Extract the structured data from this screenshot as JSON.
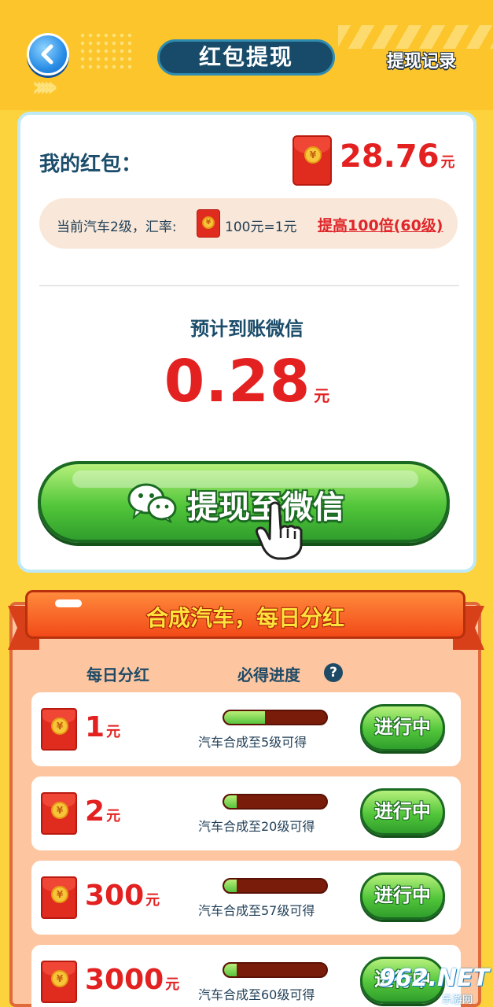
{
  "header": {
    "title": "红包提现",
    "history_link": "提现记录",
    "back_icon": "chevron-left-icon"
  },
  "balance": {
    "label": "我的红包：",
    "amount": "28.76",
    "unit": "元"
  },
  "rate": {
    "text": "当前汽车2级，汇率:",
    "value": "100元=1元",
    "boost_link": "提高100倍(60级)"
  },
  "expected": {
    "label": "预计到账微信",
    "amount": "0.28",
    "unit": "元"
  },
  "withdraw_button": {
    "label": "提现至微信",
    "icon": "wechat-icon"
  },
  "daily": {
    "banner": "合成汽车，每日分红",
    "col_reward": "每日分红",
    "col_progress": "必得进度",
    "help_icon": "?",
    "rows": [
      {
        "amount": "1",
        "unit": "元",
        "progress": 0.4,
        "condition": "汽车合成至5级可得",
        "status": "进行中"
      },
      {
        "amount": "2",
        "unit": "元",
        "progress": 0.1,
        "condition": "汽车合成至20级可得",
        "status": "进行中"
      },
      {
        "amount": "300",
        "unit": "元",
        "progress": 0.03,
        "condition": "汽车合成至57级可得",
        "status": "进行中"
      },
      {
        "amount": "3000",
        "unit": "元",
        "progress": 0.03,
        "condition": "汽车合成至60级可得",
        "status": "进行中"
      }
    ]
  },
  "watermark": {
    "text": "962.NET",
    "sub": "乐游网"
  },
  "colors": {
    "background": "#fcd33c",
    "title_bg": "#184b69",
    "accent_red": "#e32121",
    "button_green": "#52c63a",
    "panel": "#fdc6a0"
  }
}
